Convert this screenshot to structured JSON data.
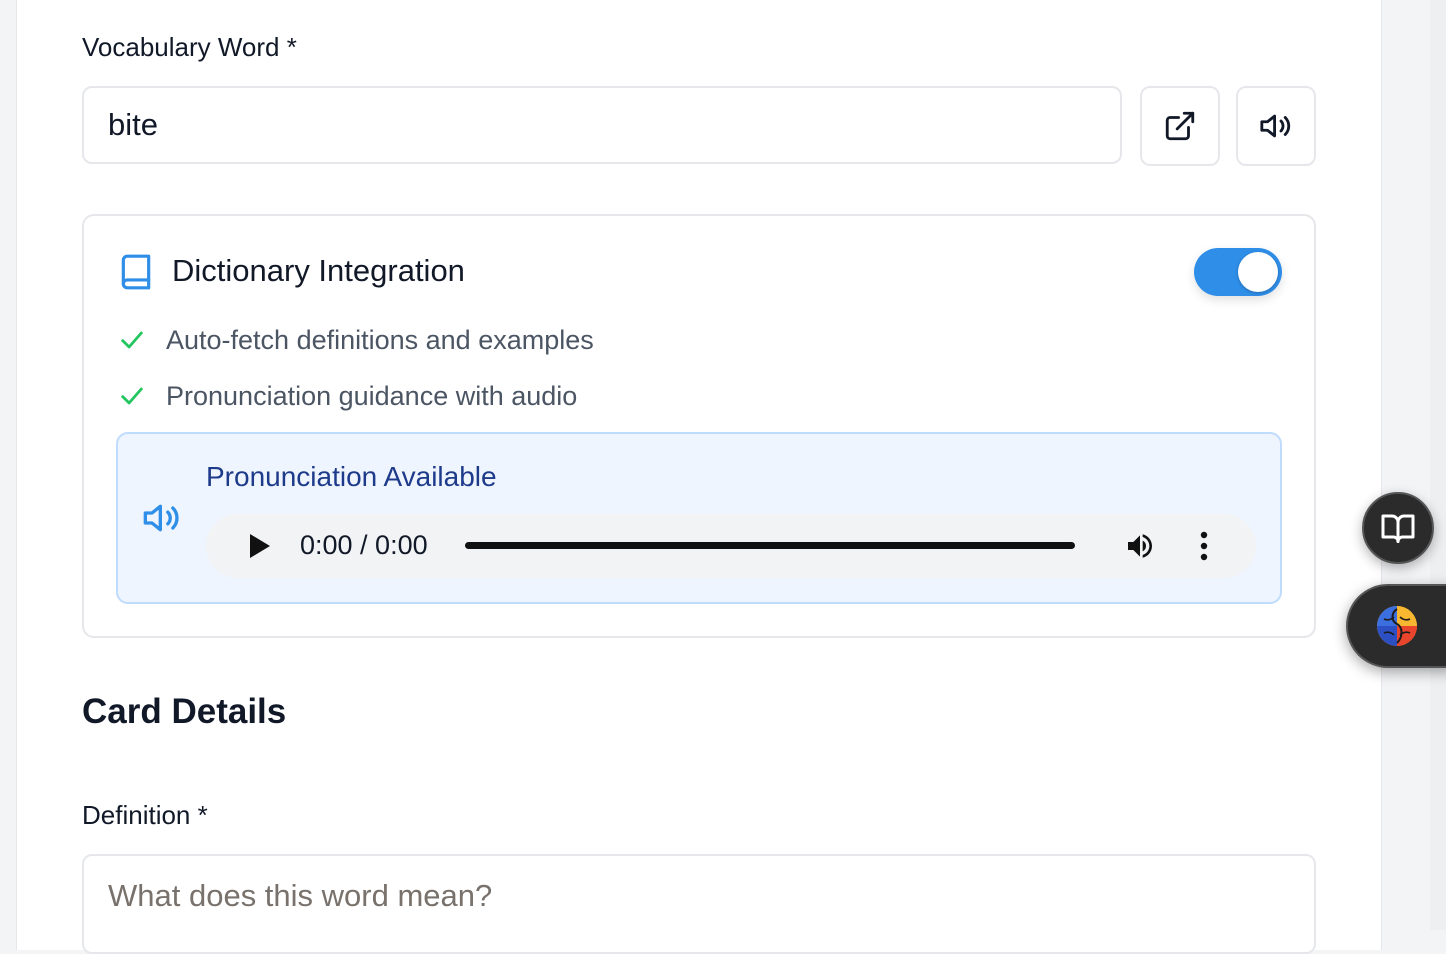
{
  "form": {
    "vocab_label": "Vocabulary Word *",
    "vocab_value": "bite",
    "external_link_icon": "external-link-icon",
    "speaker_icon": "speaker-icon"
  },
  "dictionary": {
    "title": "Dictionary Integration",
    "icon": "book-icon",
    "enabled": true,
    "toggle_color": "#2f8ee8",
    "features": [
      "Auto-fetch definitions and examples",
      "Pronunciation guidance with audio"
    ],
    "check_color": "#22c55e",
    "pronunciation": {
      "title": "Pronunciation Available",
      "time": "0:00 / 0:00"
    }
  },
  "card_details": {
    "title": "Card Details",
    "definition_label": "Definition *",
    "definition_placeholder": "What does this word mean?"
  },
  "side_buttons": {
    "reader": "open-book-icon",
    "brain": "colorful-brain-icon"
  }
}
